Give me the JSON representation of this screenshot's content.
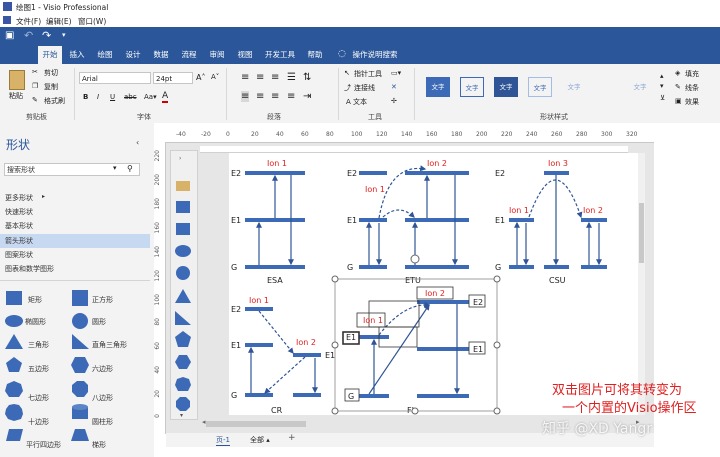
{
  "app": {
    "title": "绘图1 - Visio Professional",
    "menu": [
      "文件(F)",
      "编辑(E)",
      "窗口(W)"
    ]
  },
  "ribbon": {
    "tabs": [
      "开始",
      "插入",
      "绘图",
      "设计",
      "数据",
      "流程",
      "审阅",
      "视图",
      "开发工具",
      "帮助",
      "操作说明搜索"
    ],
    "active_tab": "开始",
    "clipboard": {
      "paste": "粘贴",
      "cut": "剪切",
      "copy": "复制",
      "format_painter": "格式刷",
      "label": "剪贴板"
    },
    "font": {
      "family": "Arial",
      "size": "24pt",
      "label": "字体"
    },
    "paragraph": {
      "label": "段落"
    },
    "tools": {
      "pointer": "指针工具",
      "connector": "连接线",
      "text": "A 文本",
      "label": "工具"
    },
    "shape_styles": {
      "items": [
        "文字",
        "文字",
        "文字",
        "文字",
        "文字",
        "文字"
      ],
      "label": "形状样式"
    },
    "right": {
      "fill": "填充",
      "line": "线条",
      "effect": "效果"
    }
  },
  "shapes_panel": {
    "title": "形状",
    "search_placeholder": "搜索形状",
    "categories": [
      "更多形状",
      "快速形状",
      "基本形状",
      "箭头形状",
      "图案形状",
      "图表和数学图形"
    ],
    "active_category": "箭头形状",
    "shapes": [
      "矩形",
      "正方形",
      "椭圆形",
      "圆形",
      "三角形",
      "直角三角形",
      "五边形",
      "六边形",
      "七边形",
      "八边形",
      "十边形",
      "圆柱形",
      "平行四边形",
      "梯形"
    ]
  },
  "ruler": {
    "h": [
      "-40",
      "-20",
      "0",
      "20",
      "40",
      "60",
      "80",
      "100",
      "120",
      "140",
      "160",
      "180",
      "200",
      "220",
      "240",
      "260",
      "280",
      "300",
      "320"
    ],
    "v": [
      "220",
      "200",
      "180",
      "160",
      "140",
      "120",
      "100",
      "80",
      "60",
      "40",
      "20",
      "0"
    ]
  },
  "diagram": {
    "levels": {
      "e2": "E2",
      "e1": "E1",
      "g": "G"
    },
    "ions": {
      "ion1": "Ion 1",
      "ion2": "Ion 2",
      "ion3": "Ion 3"
    },
    "captions": {
      "esa": "ESA",
      "etu": "ETU",
      "csu": "CSU",
      "cr": "CR",
      "fl": "FL"
    }
  },
  "overlay_note": {
    "line1": "双击图片可将其转变为",
    "line2": "一个内置的Visio操作区"
  },
  "watermark": "知乎 @XD Yangr",
  "footer": {
    "page_tab": "页-1",
    "all_pages": "全部 ▴",
    "add_page": "+"
  }
}
